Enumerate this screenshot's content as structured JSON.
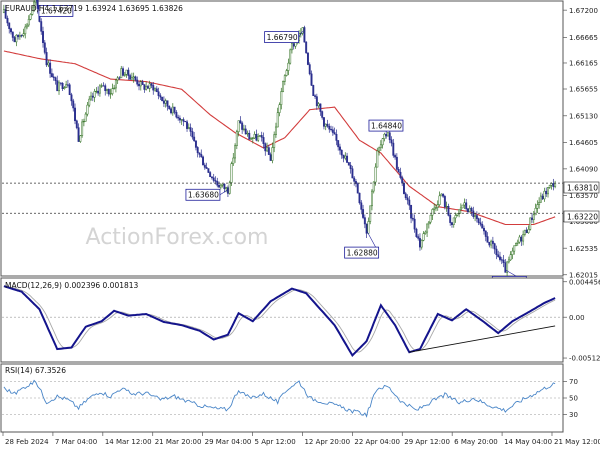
{
  "colors": {
    "bull": "#2e6f1f",
    "bear": "#2b2f8e",
    "sma": "#d23c3c",
    "macd": "#14148c",
    "signal": "#a8a8a8",
    "rsi": "#4a86c8",
    "grid": "#c8c8c8",
    "frame": "#555555",
    "label_border": "#1e1e9a",
    "watermark": "#d4d4d4"
  },
  "price_panel": {
    "title": "EURAUD,H4  1.63719 1.63924 1.63695 1.63826",
    "watermark": "ActionForex.com",
    "y_ticks": [
      "1.67200",
      "1.66665",
      "1.66165",
      "1.65655",
      "1.65130",
      "1.64605",
      "1.64090",
      "1.63570",
      "1.63060",
      "1.62535",
      "1.62015"
    ],
    "current_price": "1.63810",
    "support_level": "1.63220",
    "annotations": [
      "1.67420",
      "1.66790",
      "1.63680",
      "1.64840",
      "1.62880",
      "1.62110"
    ]
  },
  "macd_panel": {
    "title": "MACD(12,26,9) 0.002396 0.001813",
    "y_ticks": [
      "0.004456",
      "0.00",
      "-0.005128"
    ]
  },
  "rsi_panel": {
    "title": "RSI(14) 67.3526",
    "y_ticks": [
      "70",
      "50",
      "30"
    ]
  },
  "x_ticks": [
    "28 Feb 2024",
    "7 Mar 04:00",
    "14 Mar 12:00",
    "21 Mar 20:00",
    "29 Mar 04:00",
    "5 Apr 12:00",
    "12 Apr 20:00",
    "22 Apr 04:00",
    "29 Apr 12:00",
    "6 May 20:00",
    "14 May 04:00",
    "21 May 12:00"
  ],
  "chart_data": {
    "type": "candlestick",
    "instrument": "EURAUD",
    "timeframe": "H4",
    "ylim": [
      1.6201,
      1.6736
    ],
    "price_path": [
      [
        0,
        1.6715
      ],
      [
        6,
        1.6661
      ],
      [
        12,
        1.6685
      ],
      [
        18,
        1.6742
      ],
      [
        24,
        1.662
      ],
      [
        30,
        1.6568
      ],
      [
        36,
        1.658
      ],
      [
        42,
        1.647
      ],
      [
        48,
        1.654
      ],
      [
        54,
        1.657
      ],
      [
        60,
        1.656
      ],
      [
        66,
        1.66
      ],
      [
        72,
        1.659
      ],
      [
        78,
        1.657
      ],
      [
        84,
        1.657
      ],
      [
        90,
        1.654
      ],
      [
        96,
        1.652
      ],
      [
        102,
        1.65
      ],
      [
        108,
        1.645
      ],
      [
        114,
        1.641
      ],
      [
        120,
        1.638
      ],
      [
        126,
        1.6368
      ],
      [
        132,
        1.65
      ],
      [
        138,
        1.647
      ],
      [
        144,
        1.647
      ],
      [
        150,
        1.643
      ],
      [
        156,
        1.656
      ],
      [
        162,
        1.665
      ],
      [
        168,
        1.6679
      ],
      [
        174,
        1.656
      ],
      [
        180,
        1.65
      ],
      [
        186,
        1.647
      ],
      [
        192,
        1.643
      ],
      [
        198,
        1.638
      ],
      [
        204,
        1.6288
      ],
      [
        210,
        1.644
      ],
      [
        216,
        1.6484
      ],
      [
        222,
        1.64
      ],
      [
        228,
        1.633
      ],
      [
        234,
        1.626
      ],
      [
        240,
        1.632
      ],
      [
        246,
        1.636
      ],
      [
        252,
        1.63
      ],
      [
        258,
        1.634
      ],
      [
        264,
        1.632
      ],
      [
        270,
        1.628
      ],
      [
        276,
        1.625
      ],
      [
        282,
        1.6211
      ],
      [
        288,
        1.626
      ],
      [
        294,
        1.629
      ],
      [
        300,
        1.634
      ],
      [
        306,
        1.637
      ],
      [
        310,
        1.6383
      ]
    ],
    "sma": [
      [
        0,
        1.664
      ],
      [
        20,
        1.6625
      ],
      [
        40,
        1.6615
      ],
      [
        60,
        1.6585
      ],
      [
        80,
        1.658
      ],
      [
        100,
        1.6565
      ],
      [
        116,
        1.6515
      ],
      [
        130,
        1.648
      ],
      [
        146,
        1.645
      ],
      [
        158,
        1.647
      ],
      [
        172,
        1.6525
      ],
      [
        186,
        1.653
      ],
      [
        200,
        1.6465
      ],
      [
        212,
        1.644
      ],
      [
        228,
        1.6375
      ],
      [
        244,
        1.6335
      ],
      [
        262,
        1.6325
      ],
      [
        282,
        1.63
      ],
      [
        298,
        1.63
      ],
      [
        310,
        1.6315
      ]
    ],
    "levels": {
      "resistance_dotted": 1.6381,
      "support_dotted": 1.6322
    },
    "swing_labels": [
      {
        "label": "1.67420",
        "bar": 18,
        "price": 1.6742
      },
      {
        "label": "1.66790",
        "bar": 168,
        "price": 1.6679
      },
      {
        "label": "1.63680",
        "bar": 126,
        "price": 1.6368
      },
      {
        "label": "1.64840",
        "bar": 216,
        "price": 1.6484
      },
      {
        "label": "1.62880",
        "bar": 204,
        "price": 1.6288
      },
      {
        "label": "1.62110",
        "bar": 282,
        "price": 1.6211
      }
    ],
    "macd": {
      "ylim": [
        -0.0055,
        0.0048
      ],
      "series_path": [
        [
          0,
          0.0039
        ],
        [
          10,
          0.0032
        ],
        [
          20,
          0.001
        ],
        [
          30,
          -0.004
        ],
        [
          38,
          -0.0038
        ],
        [
          46,
          -0.0012
        ],
        [
          55,
          -0.0005
        ],
        [
          62,
          0.0008
        ],
        [
          70,
          0.0002
        ],
        [
          80,
          0.0004
        ],
        [
          90,
          -0.0006
        ],
        [
          100,
          -0.001
        ],
        [
          110,
          -0.0017
        ],
        [
          118,
          -0.0028
        ],
        [
          126,
          -0.0022
        ],
        [
          132,
          0.0005
        ],
        [
          140,
          -0.0005
        ],
        [
          150,
          0.002
        ],
        [
          162,
          0.0036
        ],
        [
          170,
          0.003
        ],
        [
          178,
          0.001
        ],
        [
          186,
          -0.001
        ],
        [
          196,
          -0.0048
        ],
        [
          204,
          -0.003
        ],
        [
          212,
          0.0015
        ],
        [
          220,
          -0.001
        ],
        [
          228,
          -0.0044
        ],
        [
          234,
          -0.004
        ],
        [
          244,
          0.0004
        ],
        [
          252,
          -0.0004
        ],
        [
          260,
          0.001
        ],
        [
          270,
          -0.0006
        ],
        [
          278,
          -0.002
        ],
        [
          286,
          -0.0005
        ],
        [
          294,
          0.0005
        ],
        [
          304,
          0.0018
        ],
        [
          310,
          0.0024
        ]
      ],
      "signal_lag_bars": 5,
      "trendline": [
        [
          228,
          -0.0044
        ],
        [
          310,
          -0.0011
        ]
      ]
    },
    "rsi": {
      "ylim": [
        10,
        90
      ],
      "series_path": [
        [
          0,
          62
        ],
        [
          6,
          55
        ],
        [
          12,
          64
        ],
        [
          18,
          70
        ],
        [
          24,
          45
        ],
        [
          30,
          52
        ],
        [
          36,
          48
        ],
        [
          42,
          38
        ],
        [
          48,
          50
        ],
        [
          54,
          58
        ],
        [
          60,
          52
        ],
        [
          66,
          62
        ],
        [
          72,
          55
        ],
        [
          80,
          56
        ],
        [
          88,
          48
        ],
        [
          96,
          52
        ],
        [
          104,
          45
        ],
        [
          112,
          40
        ],
        [
          120,
          37
        ],
        [
          126,
          36
        ],
        [
          132,
          60
        ],
        [
          138,
          50
        ],
        [
          146,
          55
        ],
        [
          154,
          45
        ],
        [
          160,
          62
        ],
        [
          166,
          70
        ],
        [
          172,
          50
        ],
        [
          180,
          45
        ],
        [
          188,
          40
        ],
        [
          196,
          34
        ],
        [
          204,
          30
        ],
        [
          210,
          62
        ],
        [
          216,
          64
        ],
        [
          224,
          45
        ],
        [
          232,
          35
        ],
        [
          240,
          45
        ],
        [
          248,
          54
        ],
        [
          256,
          44
        ],
        [
          264,
          50
        ],
        [
          272,
          42
        ],
        [
          282,
          35
        ],
        [
          290,
          46
        ],
        [
          298,
          55
        ],
        [
          306,
          64
        ],
        [
          310,
          67.35
        ]
      ]
    }
  }
}
